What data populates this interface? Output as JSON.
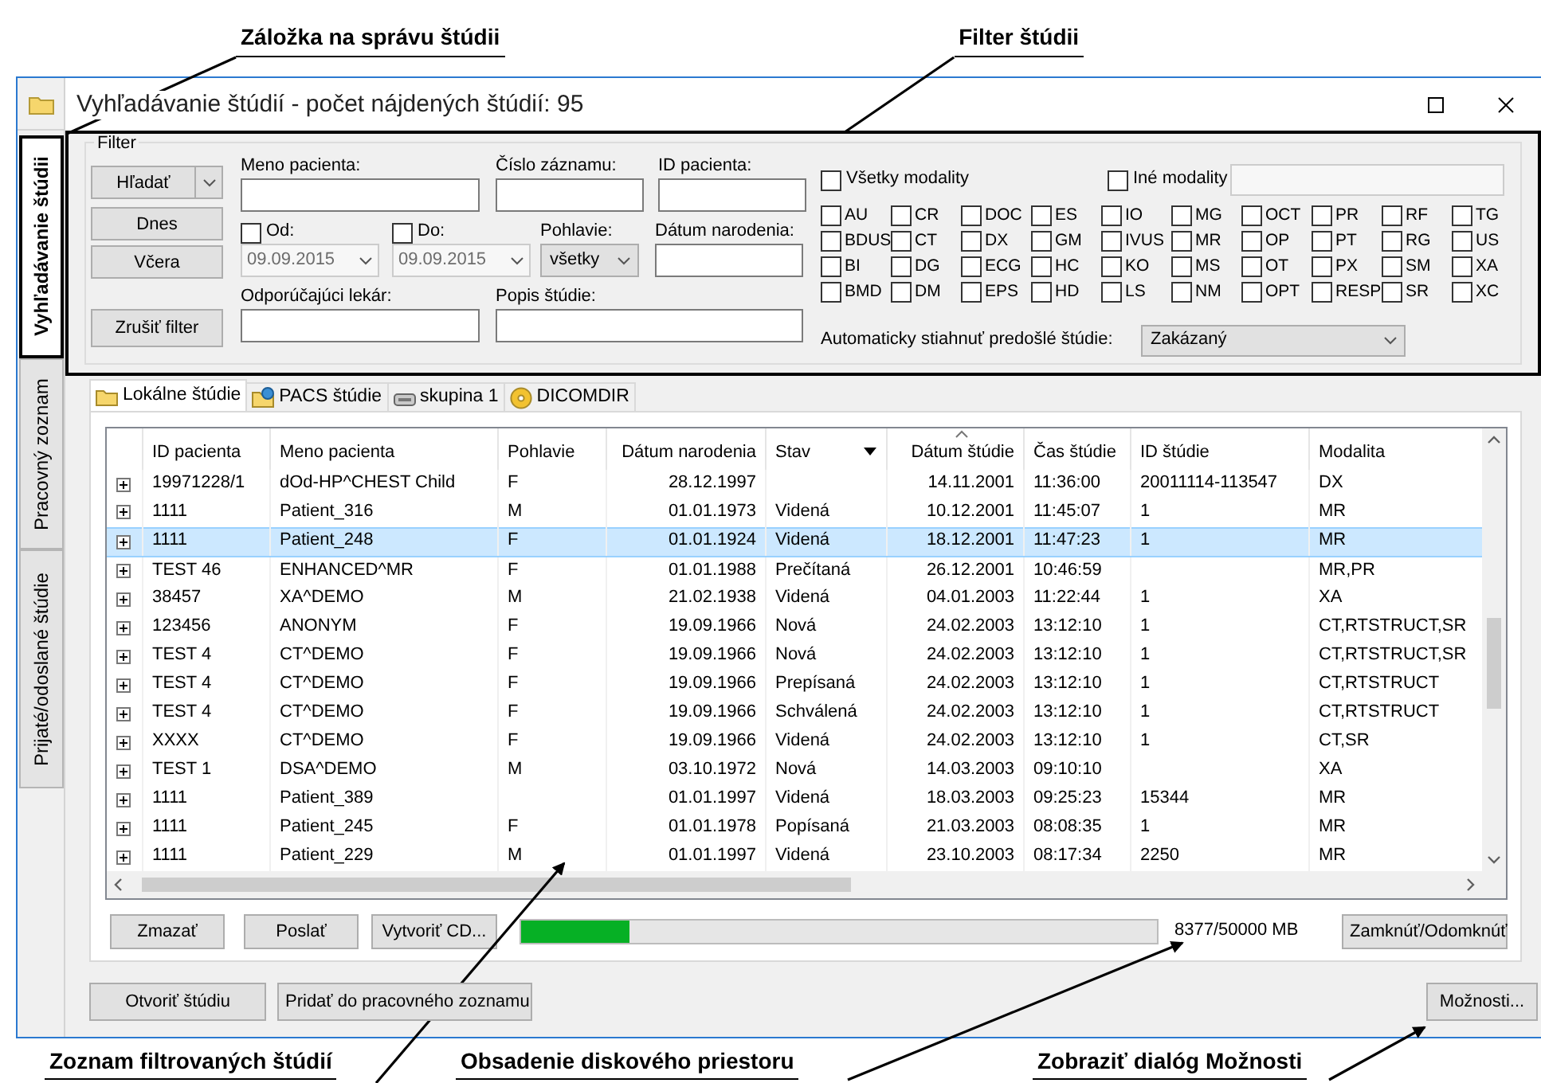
{
  "annotations_top": [
    {
      "text": "Záložka na správu štúdii"
    },
    {
      "text": "Filter štúdii"
    }
  ],
  "window": {
    "title": "Vyhľadávanie štúdií - počet nájdených štúdií: 95"
  },
  "side_tabs": [
    {
      "label": "Vyhľadávanie štúdii",
      "selected": true
    },
    {
      "label": "Pracovný zoznam",
      "selected": false
    },
    {
      "label": "Prijaté/odoslané štúdie",
      "selected": false
    }
  ],
  "filter": {
    "group_label": "Filter",
    "search_button": "Hľadať",
    "today_button": "Dnes",
    "yesterday_button": "Včera",
    "clear_button": "Zrušiť filter",
    "patient_name": {
      "label": "Meno pacienta:"
    },
    "record_number": {
      "label": "Číslo záznamu:"
    },
    "patient_id": {
      "label": "ID pacienta:"
    },
    "date_from": {
      "label": "Od:",
      "checked": false,
      "value": "09.09.2015",
      "disabled": true
    },
    "date_to": {
      "label": "Do:",
      "checked": false,
      "value": "09.09.2015",
      "disabled": true
    },
    "sex": {
      "label": "Pohlavie:",
      "value": "všetky"
    },
    "birth_date": {
      "label": "Dátum narodenia:"
    },
    "referring_physician": {
      "label": "Odporúčajúci lekár:"
    },
    "study_description": {
      "label": "Popis štúdie:"
    },
    "all_modalities": {
      "label": "Všetky modality",
      "checked": false
    },
    "other_modalities": {
      "label": "Iné modality",
      "checked": false
    },
    "modalities": [
      {
        "label": "AU",
        "checked": false
      },
      {
        "label": "CR",
        "checked": false
      },
      {
        "label": "DOC",
        "checked": false
      },
      {
        "label": "ES",
        "checked": false
      },
      {
        "label": "IO",
        "checked": false
      },
      {
        "label": "MG",
        "checked": false
      },
      {
        "label": "OCT",
        "checked": false
      },
      {
        "label": "PR",
        "checked": false
      },
      {
        "label": "RF",
        "checked": false
      },
      {
        "label": "TG",
        "checked": false
      },
      {
        "label": "BDUS",
        "checked": false
      },
      {
        "label": "CT",
        "checked": false
      },
      {
        "label": "DX",
        "checked": false
      },
      {
        "label": "GM",
        "checked": false
      },
      {
        "label": "IVUS",
        "checked": false
      },
      {
        "label": "MR",
        "checked": false
      },
      {
        "label": "OP",
        "checked": false
      },
      {
        "label": "PT",
        "checked": false
      },
      {
        "label": "RG",
        "checked": false
      },
      {
        "label": "US",
        "checked": false
      },
      {
        "label": "BI",
        "checked": false
      },
      {
        "label": "DG",
        "checked": false
      },
      {
        "label": "ECG",
        "checked": false
      },
      {
        "label": "HC",
        "checked": false
      },
      {
        "label": "KO",
        "checked": false
      },
      {
        "label": "MS",
        "checked": false
      },
      {
        "label": "OT",
        "checked": false
      },
      {
        "label": "PX",
        "checked": false
      },
      {
        "label": "SM",
        "checked": false
      },
      {
        "label": "XA",
        "checked": false
      },
      {
        "label": "BMD",
        "checked": false
      },
      {
        "label": "DM",
        "checked": false
      },
      {
        "label": "EPS",
        "checked": false
      },
      {
        "label": "HD",
        "checked": false
      },
      {
        "label": "LS",
        "checked": false
      },
      {
        "label": "NM",
        "checked": false
      },
      {
        "label": "OPT",
        "checked": false
      },
      {
        "label": "RESP",
        "checked": false
      },
      {
        "label": "SR",
        "checked": false
      },
      {
        "label": "XC",
        "checked": false
      }
    ],
    "auto_download": {
      "label": "Automaticky stiahnuť predošlé štúdie:",
      "value": "Zakázaný"
    }
  },
  "study_tabs": [
    {
      "label": "Lokálne štúdie",
      "selected": true
    },
    {
      "label": "PACS štúdie",
      "selected": false
    },
    {
      "label": "skupina 1",
      "selected": false
    },
    {
      "label": "DICOMDIR",
      "selected": false
    }
  ],
  "table": {
    "columns": [
      {
        "label": "ID pacienta",
        "sorted": false,
        "filter": false
      },
      {
        "label": "Meno pacienta",
        "sorted": false,
        "filter": false
      },
      {
        "label": "Pohlavie",
        "sorted": false,
        "filter": false
      },
      {
        "label": "Dátum narodenia",
        "sorted": false,
        "filter": false
      },
      {
        "label": "Stav",
        "sorted": false,
        "filter": true
      },
      {
        "label": "Dátum štúdie",
        "sorted": true,
        "filter": false
      },
      {
        "label": "Čas štúdie",
        "sorted": false,
        "filter": false
      },
      {
        "label": "ID štúdie",
        "sorted": false,
        "filter": false
      },
      {
        "label": "Modalita",
        "sorted": false,
        "filter": false
      }
    ],
    "rows": [
      {
        "patient_id": "19971228/1",
        "name": "dOd-HP^CHEST Child",
        "sex": "F",
        "birth_date": "28.12.1997",
        "study_date": "14.11.2001",
        "study_time": "11:36:00",
        "study_id": "20011114-113547",
        "modality": "DX",
        "selected": false,
        "expanded": false
      },
      {
        "patient_id": "1111",
        "name": "Patient_316",
        "sex": "M",
        "birth_date": "01.01.1973",
        "status": "Videná",
        "study_date": "10.12.2001",
        "study_time": "11:45:07",
        "study_id": "1",
        "modality": "MR",
        "selected": false,
        "expanded": false
      },
      {
        "patient_id": "1111",
        "name": "Patient_248",
        "sex": "F",
        "birth_date": "01.01.1924",
        "status": "Videná",
        "study_date": "18.12.2001",
        "study_time": "11:47:23",
        "study_id": "1",
        "modality": "MR",
        "selected": true,
        "expanded": false
      },
      {
        "patient_id": "TEST 46",
        "name": "ENHANCED^MR",
        "sex": "F",
        "birth_date": "01.01.1988",
        "status": "Prečítaná",
        "study_date": "26.12.2001",
        "study_time": "10:46:59",
        "modality": "MR,PR",
        "selected": false,
        "expanded": false
      },
      {
        "patient_id": "38457",
        "name": "XA^DEMO",
        "sex": "M",
        "birth_date": "21.02.1938",
        "status": "Videná",
        "study_date": "04.01.2003",
        "study_time": "11:22:44",
        "study_id": "1",
        "modality": "XA",
        "selected": false,
        "expanded": false
      },
      {
        "patient_id": "123456",
        "name": "ANONYM",
        "sex": "F",
        "birth_date": "19.09.1966",
        "status": "Nová",
        "study_date": "24.02.2003",
        "study_time": "13:12:10",
        "study_id": "1",
        "modality": "CT,RTSTRUCT,SR",
        "selected": false,
        "expanded": false
      },
      {
        "patient_id": "TEST 4",
        "name": "CT^DEMO",
        "sex": "F",
        "birth_date": "19.09.1966",
        "status": "Nová",
        "study_date": "24.02.2003",
        "study_time": "13:12:10",
        "study_id": "1",
        "modality": "CT,RTSTRUCT,SR",
        "selected": false,
        "expanded": false
      },
      {
        "patient_id": "TEST 4",
        "name": "CT^DEMO",
        "sex": "F",
        "birth_date": "19.09.1966",
        "status": "Prepísaná",
        "study_date": "24.02.2003",
        "study_time": "13:12:10",
        "study_id": "1",
        "modality": "CT,RTSTRUCT",
        "selected": false,
        "expanded": false
      },
      {
        "patient_id": "TEST 4",
        "name": "CT^DEMO",
        "sex": "F",
        "birth_date": "19.09.1966",
        "status": "Schválená",
        "study_date": "24.02.2003",
        "study_time": "13:12:10",
        "study_id": "1",
        "modality": "CT,RTSTRUCT",
        "selected": false,
        "expanded": false
      },
      {
        "patient_id": "XXXX",
        "name": "CT^DEMO",
        "sex": "F",
        "birth_date": "19.09.1966",
        "status": "Videná",
        "study_date": "24.02.2003",
        "study_time": "13:12:10",
        "study_id": "1",
        "modality": "CT,SR",
        "selected": false,
        "expanded": false
      },
      {
        "patient_id": "TEST 1",
        "name": "DSA^DEMO",
        "sex": "M",
        "birth_date": "03.10.1972",
        "status": "Nová",
        "study_date": "14.03.2003",
        "study_time": "09:10:10",
        "modality": "XA",
        "selected": false,
        "expanded": false
      },
      {
        "patient_id": "1111",
        "name": "Patient_389",
        "birth_date": "01.01.1997",
        "status": "Videná",
        "study_date": "18.03.2003",
        "study_time": "09:25:23",
        "study_id": "15344",
        "modality": "MR",
        "selected": false,
        "expanded": false
      },
      {
        "patient_id": "1111",
        "name": "Patient_245",
        "sex": "F",
        "birth_date": "01.01.1978",
        "status": "Popísaná",
        "study_date": "21.03.2003",
        "study_time": "08:08:35",
        "study_id": "1",
        "modality": "MR",
        "selected": false,
        "expanded": false
      },
      {
        "patient_id": "1111",
        "name": "Patient_229",
        "sex": "M",
        "birth_date": "01.01.1997",
        "status": "Videná",
        "study_date": "23.10.2003",
        "study_time": "08:17:34",
        "study_id": "2250",
        "modality": "MR",
        "selected": false,
        "expanded": false
      }
    ]
  },
  "panel_buttons": [
    "Zmazať",
    "Poslať",
    "Vytvoriť CD..."
  ],
  "disk_usage": {
    "level": 0.17,
    "reading": "8377/50000 MB"
  },
  "lock_button": "Zamknúť/Odomknúť",
  "footer_buttons": [
    "Otvoriť štúdiu",
    "Pridať do pracovného zoznamu"
  ],
  "options_button": "Možnosti...",
  "annotations_bottom": [
    {
      "text": "Zoznam filtrovaných štúdií"
    },
    {
      "text": "Obsadenie diskového priestoru"
    },
    {
      "text": "Zobraziť dialóg Možnosti"
    }
  ]
}
